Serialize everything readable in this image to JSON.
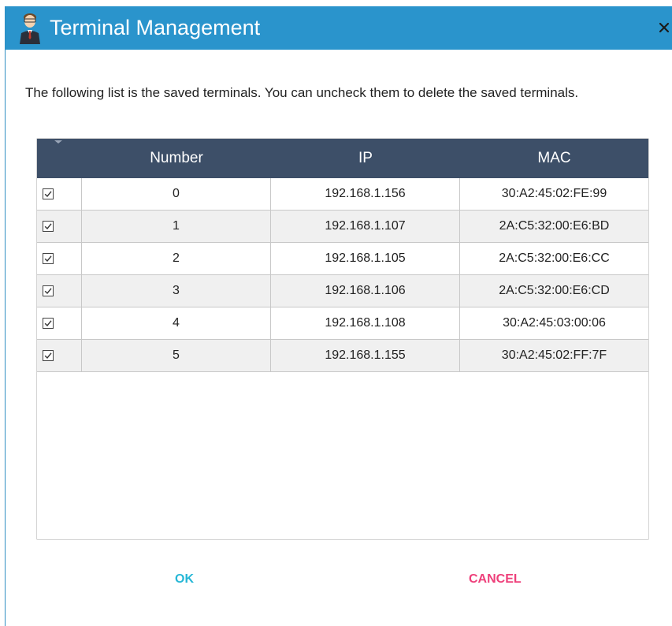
{
  "dialog": {
    "title": "Terminal Management",
    "description": "The following list is the saved terminals. You can uncheck them to delete the saved terminals.",
    "close_glyph": "×"
  },
  "table": {
    "columns": [
      "Number",
      "IP",
      "MAC"
    ],
    "rows": [
      {
        "checked": true,
        "number": "0",
        "ip": "192.168.1.156",
        "mac": "30:A2:45:02:FE:99"
      },
      {
        "checked": true,
        "number": "1",
        "ip": "192.168.1.107",
        "mac": "2A:C5:32:00:E6:BD"
      },
      {
        "checked": true,
        "number": "2",
        "ip": "192.168.1.105",
        "mac": "2A:C5:32:00:E6:CC"
      },
      {
        "checked": true,
        "number": "3",
        "ip": "192.168.1.106",
        "mac": "2A:C5:32:00:E6:CD"
      },
      {
        "checked": true,
        "number": "4",
        "ip": "192.168.1.108",
        "mac": "30:A2:45:03:00:06"
      },
      {
        "checked": true,
        "number": "5",
        "ip": "192.168.1.155",
        "mac": "30:A2:45:02:FF:7F"
      }
    ]
  },
  "buttons": {
    "ok_label": "OK",
    "cancel_label": "CANCEL"
  },
  "colors": {
    "titlebar": "#2a94cc",
    "table_header": "#3d4f68",
    "ok": "#26b7d6",
    "cancel": "#ee3f7a"
  },
  "icons": {
    "title_icon": "user-avatar-icon",
    "close_icon": "close-icon",
    "checkbox_icon": "checkmark-icon",
    "sort_icon": "caret-down-icon"
  }
}
